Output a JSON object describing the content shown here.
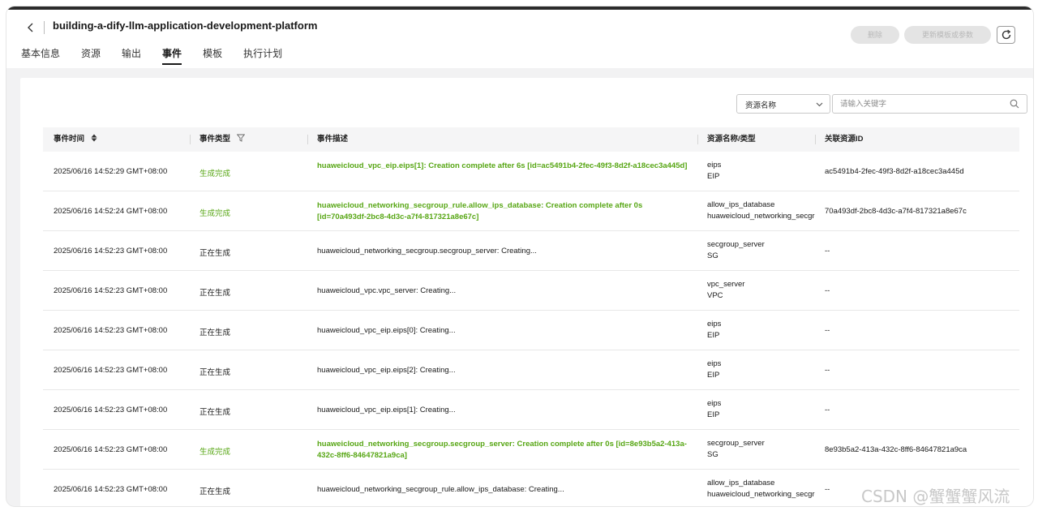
{
  "header": {
    "title": "building-a-dify-llm-application-development-platform",
    "delete_label": "删除",
    "update_label": "更新模板或参数",
    "tabs": [
      "基本信息",
      "资源",
      "输出",
      "事件",
      "模板",
      "执行计划"
    ],
    "active_tab": "事件"
  },
  "filter": {
    "select_value": "资源名称",
    "search_placeholder": "请输入关键字"
  },
  "table": {
    "columns": [
      "事件时间",
      "事件类型",
      "事件描述",
      "资源名称/类型",
      "关联资源ID"
    ],
    "rows": [
      {
        "time": "2025/06/16 14:52:29 GMT+08:00",
        "type": "生成完成",
        "status": "done",
        "desc": "huaweicloud_vpc_eip.eips[1]: Creation complete after 6s [id=ac5491b4-2fec-49f3-8d2f-a18cec3a445d]",
        "res_name": "eips",
        "res_type": "EIP",
        "res_id": "ac5491b4-2fec-49f3-8d2f-a18cec3a445d"
      },
      {
        "time": "2025/06/16 14:52:24 GMT+08:00",
        "type": "生成完成",
        "status": "done",
        "desc": "huaweicloud_networking_secgroup_rule.allow_ips_database: Creation complete after 0s [id=70a493df-2bc8-4d3c-a7f4-817321a8e67c]",
        "res_name": "allow_ips_database",
        "res_type": "huaweicloud_networking_secgroup_rule",
        "res_id": "70a493df-2bc8-4d3c-a7f4-817321a8e67c"
      },
      {
        "time": "2025/06/16 14:52:23 GMT+08:00",
        "type": "正在生成",
        "status": "creating",
        "desc": "huaweicloud_networking_secgroup.secgroup_server: Creating...",
        "res_name": "secgroup_server",
        "res_type": "SG",
        "res_id": "--"
      },
      {
        "time": "2025/06/16 14:52:23 GMT+08:00",
        "type": "正在生成",
        "status": "creating",
        "desc": "huaweicloud_vpc.vpc_server: Creating...",
        "res_name": "vpc_server",
        "res_type": "VPC",
        "res_id": "--"
      },
      {
        "time": "2025/06/16 14:52:23 GMT+08:00",
        "type": "正在生成",
        "status": "creating",
        "desc": "huaweicloud_vpc_eip.eips[0]: Creating...",
        "res_name": "eips",
        "res_type": "EIP",
        "res_id": "--"
      },
      {
        "time": "2025/06/16 14:52:23 GMT+08:00",
        "type": "正在生成",
        "status": "creating",
        "desc": "huaweicloud_vpc_eip.eips[2]: Creating...",
        "res_name": "eips",
        "res_type": "EIP",
        "res_id": "--"
      },
      {
        "time": "2025/06/16 14:52:23 GMT+08:00",
        "type": "正在生成",
        "status": "creating",
        "desc": "huaweicloud_vpc_eip.eips[1]: Creating...",
        "res_name": "eips",
        "res_type": "EIP",
        "res_id": "--"
      },
      {
        "time": "2025/06/16 14:52:23 GMT+08:00",
        "type": "生成完成",
        "status": "done",
        "desc": "huaweicloud_networking_secgroup.secgroup_server: Creation complete after 0s [id=8e93b5a2-413a-432c-8ff6-84647821a9ca]",
        "res_name": "secgroup_server",
        "res_type": "SG",
        "res_id": "8e93b5a2-413a-432c-8ff6-84647821a9ca"
      },
      {
        "time": "2025/06/16 14:52:23 GMT+08:00",
        "type": "正在生成",
        "status": "creating",
        "desc": "huaweicloud_networking_secgroup_rule.allow_ips_database: Creating...",
        "res_name": "allow_ips_database",
        "res_type": "huaweicloud_networking_secgroup_rule",
        "res_id": "--"
      }
    ]
  },
  "watermark": "CSDN @蟹蟹蟹风流",
  "colors": {
    "done_green": "#57a614",
    "disabled_button": "#e4e4e4",
    "page_bg": "#f2f2f3"
  },
  "icons": {
    "back": "chevron-left-icon",
    "refresh": "refresh-icon",
    "select": "chevron-down-icon",
    "search": "search-icon",
    "sort": "sort-icon",
    "filter": "filter-icon"
  }
}
